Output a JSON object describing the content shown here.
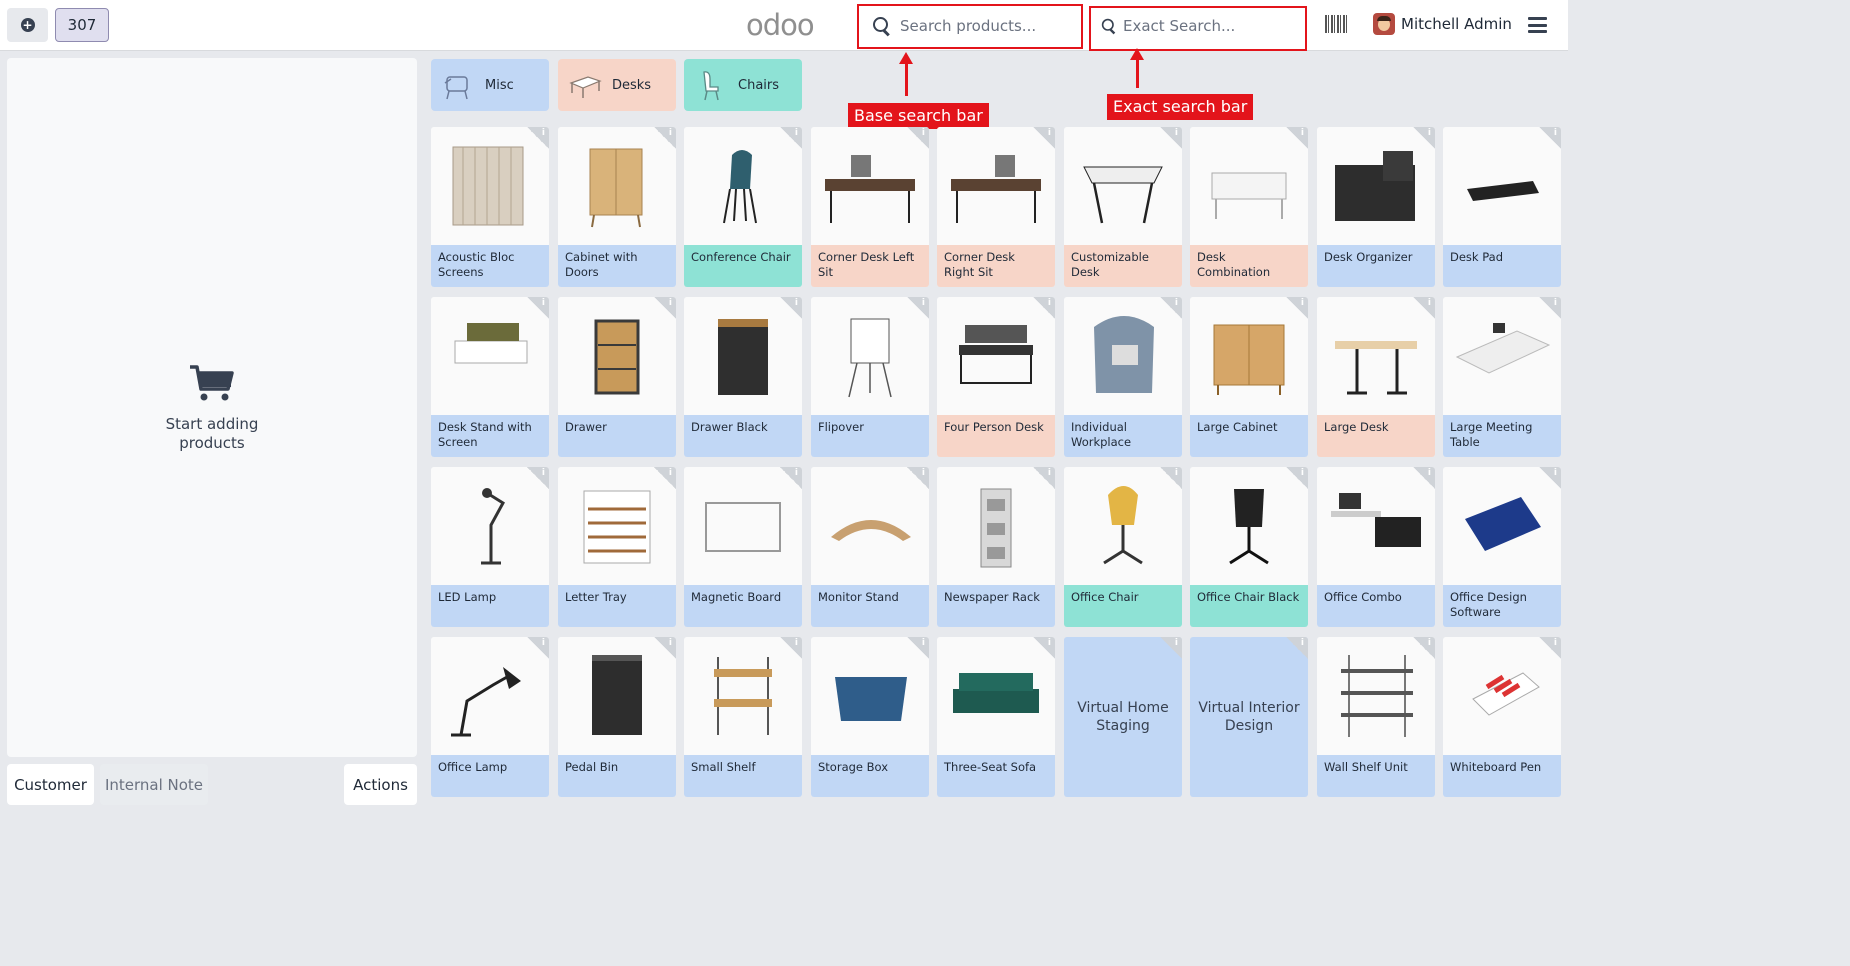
{
  "topbar": {
    "order_number": "307",
    "logo_text": "odoo",
    "search_placeholder": "Search products...",
    "exact_search_placeholder": "Exact Search...",
    "user_name": "Mitchell Admin"
  },
  "annotations": {
    "base_label": "Base search bar",
    "exact_label": "Exact search bar",
    "highlight_color": "#e3141b"
  },
  "cart": {
    "empty_text_line1": "Start adding",
    "empty_text_line2": "products"
  },
  "bottom_buttons": {
    "customer": "Customer",
    "internal_note": "Internal Note",
    "actions": "Actions"
  },
  "categories": [
    {
      "label": "Misc",
      "color": "#c1d7f5"
    },
    {
      "label": "Desks",
      "color": "#f7d5c8"
    },
    {
      "label": "Chairs",
      "color": "#8ee2d5"
    }
  ],
  "products": [
    {
      "name": "Acoustic Bloc Screens",
      "category": "misc"
    },
    {
      "name": "Cabinet with Doors",
      "category": "misc"
    },
    {
      "name": "Conference Chair",
      "category": "chairs"
    },
    {
      "name": "Corner Desk Left Sit",
      "category": "desks"
    },
    {
      "name": "Corner Desk Right Sit",
      "category": "desks"
    },
    {
      "name": "Customizable Desk",
      "category": "desks"
    },
    {
      "name": "Desk Combination",
      "category": "desks"
    },
    {
      "name": "Desk Organizer",
      "category": "misc"
    },
    {
      "name": "Desk Pad",
      "category": "misc"
    },
    {
      "name": "Desk Stand with Screen",
      "category": "misc"
    },
    {
      "name": "Drawer",
      "category": "misc"
    },
    {
      "name": "Drawer Black",
      "category": "misc"
    },
    {
      "name": "Flipover",
      "category": "misc"
    },
    {
      "name": "Four Person Desk",
      "category": "desks"
    },
    {
      "name": "Individual Workplace",
      "category": "misc"
    },
    {
      "name": "Large Cabinet",
      "category": "misc"
    },
    {
      "name": "Large Desk",
      "category": "desks"
    },
    {
      "name": "Large Meeting Table",
      "category": "misc"
    },
    {
      "name": "LED Lamp",
      "category": "misc"
    },
    {
      "name": "Letter Tray",
      "category": "misc"
    },
    {
      "name": "Magnetic Board",
      "category": "misc"
    },
    {
      "name": "Monitor Stand",
      "category": "misc"
    },
    {
      "name": "Newspaper Rack",
      "category": "misc"
    },
    {
      "name": "Office Chair",
      "category": "chairs"
    },
    {
      "name": "Office Chair Black",
      "category": "chairs"
    },
    {
      "name": "Office Combo",
      "category": "misc"
    },
    {
      "name": "Office Design Software",
      "category": "misc"
    },
    {
      "name": "Office Lamp",
      "category": "misc"
    },
    {
      "name": "Pedal Bin",
      "category": "misc"
    },
    {
      "name": "Small Shelf",
      "category": "misc"
    },
    {
      "name": "Storage Box",
      "category": "misc"
    },
    {
      "name": "Three-Seat Sofa",
      "category": "misc"
    },
    {
      "name": "Virtual Home Staging",
      "category": "misc",
      "text_only": true
    },
    {
      "name": "Virtual Interior Design",
      "category": "misc",
      "text_only": true
    },
    {
      "name": "Wall Shelf Unit",
      "category": "misc"
    },
    {
      "name": "Whiteboard Pen",
      "category": "misc"
    }
  ]
}
